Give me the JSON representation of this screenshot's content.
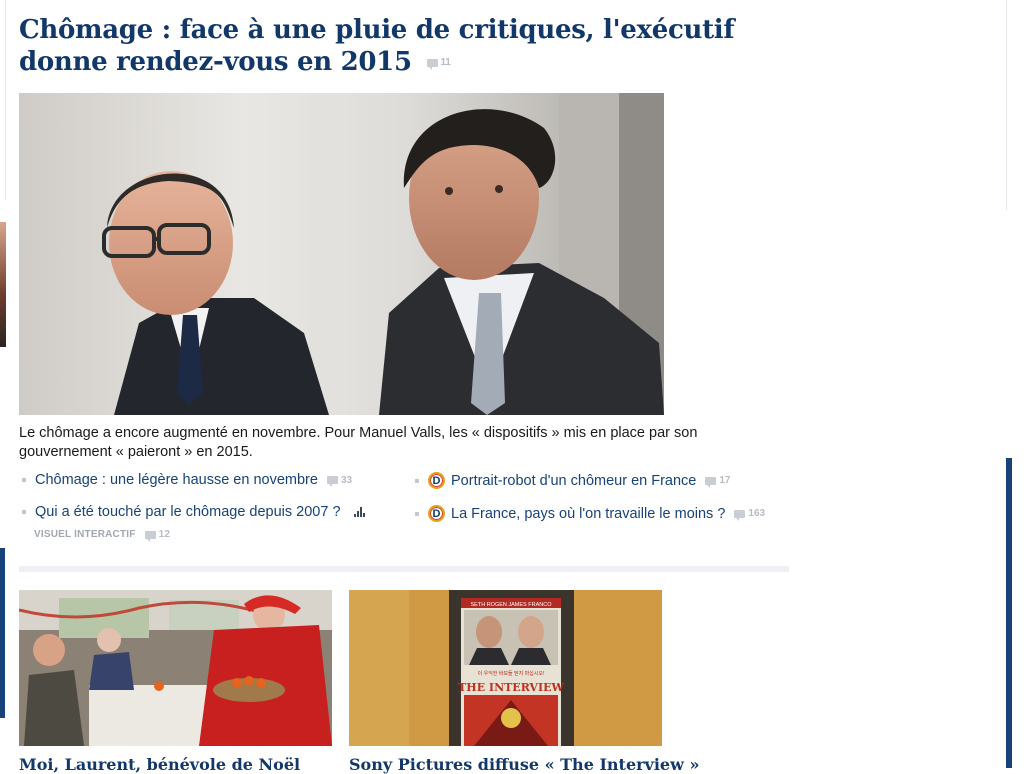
{
  "main_story": {
    "headline": "Chômage : face à une pluie de critiques, l'exécutif donne rendez-vous en 2015",
    "comment_count": "11",
    "caption": "Le chômage a encore augmenté en novembre. Pour Manuel Valls, les « dispositifs » mis en place par son gouvernement « paieront » en 2015."
  },
  "related_links": [
    {
      "label": "Chômage : une légère hausse en novembre",
      "count": "33",
      "icon": "comment-icon"
    },
    {
      "label": "Portrait-robot d'un chômeur en France",
      "count": "17",
      "icon": "decodeurs-icon"
    },
    {
      "label": "Qui a été touché par le chômage depuis 2007 ?",
      "icon": "bar-chart-icon",
      "tag": "VISUEL INTERACTIF",
      "count": "12"
    },
    {
      "label": "La France, pays où l'on travaille le moins ?",
      "count": "163",
      "icon": "decodeurs-icon"
    }
  ],
  "decodeurs_letter": "D",
  "secondary_stories": [
    {
      "title": "Moi, Laurent, bénévole de Noël"
    },
    {
      "title": "Sony Pictures diffuse « The Interview »"
    }
  ],
  "poster": {
    "top_names": "SETH ROGEN   JAMES FRANCO",
    "korean_line": "이 우익한 바보들 믿지 마십시오!",
    "title": "THE INTERVIEW"
  },
  "colors": {
    "headline": "#12386a",
    "link": "#17427a",
    "accent_blue": "#17427a",
    "muted": "#b7bcc3"
  }
}
